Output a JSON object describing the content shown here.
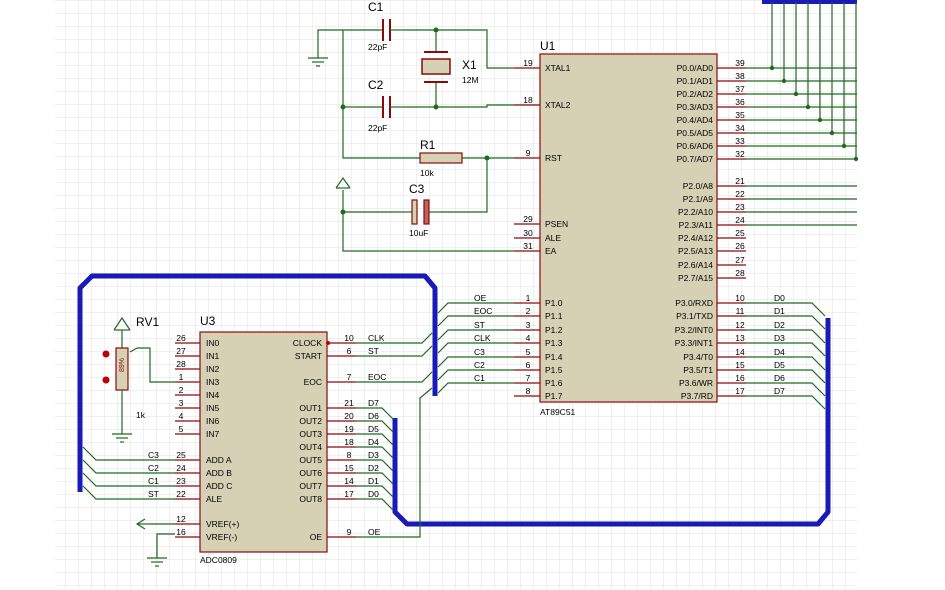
{
  "u1": {
    "ref": "U1",
    "part": "AT89C51",
    "left_pins": [
      {
        "num": "19",
        "name": "XTAL1"
      },
      {
        "num": "18",
        "name": "XTAL2"
      },
      {
        "num": "9",
        "name": "RST"
      },
      {
        "num": "29",
        "name": "PSEN"
      },
      {
        "num": "30",
        "name": "ALE"
      },
      {
        "num": "31",
        "name": "EA"
      },
      {
        "num": "1",
        "name": "P1.0"
      },
      {
        "num": "2",
        "name": "P1.1"
      },
      {
        "num": "3",
        "name": "P1.2"
      },
      {
        "num": "4",
        "name": "P1.3"
      },
      {
        "num": "5",
        "name": "P1.4"
      },
      {
        "num": "6",
        "name": "P1.5"
      },
      {
        "num": "7",
        "name": "P1.6"
      },
      {
        "num": "8",
        "name": "P1.7"
      }
    ],
    "right_pins": [
      {
        "num": "39",
        "name": "P0.0/AD0"
      },
      {
        "num": "38",
        "name": "P0.1/AD1"
      },
      {
        "num": "37",
        "name": "P0.2/AD2"
      },
      {
        "num": "36",
        "name": "P0.3/AD3"
      },
      {
        "num": "35",
        "name": "P0.4/AD4"
      },
      {
        "num": "34",
        "name": "P0.5/AD5"
      },
      {
        "num": "33",
        "name": "P0.6/AD6"
      },
      {
        "num": "32",
        "name": "P0.7/AD7"
      },
      {
        "num": "21",
        "name": "P2.0/A8"
      },
      {
        "num": "22",
        "name": "P2.1/A9"
      },
      {
        "num": "23",
        "name": "P2.2/A10"
      },
      {
        "num": "24",
        "name": "P2.3/A11"
      },
      {
        "num": "25",
        "name": "P2.4/A12"
      },
      {
        "num": "26",
        "name": "P2.5/A13"
      },
      {
        "num": "27",
        "name": "P2.6/A14"
      },
      {
        "num": "28",
        "name": "P2.7/A15"
      },
      {
        "num": "10",
        "name": "P3.0/RXD"
      },
      {
        "num": "11",
        "name": "P3.1/TXD"
      },
      {
        "num": "12",
        "name": "P3.2/INT0"
      },
      {
        "num": "13",
        "name": "P3.3/INT1"
      },
      {
        "num": "14",
        "name": "P3.4/T0"
      },
      {
        "num": "15",
        "name": "P3.5/T1"
      },
      {
        "num": "16",
        "name": "P3.6/WR"
      },
      {
        "num": "17",
        "name": "P3.7/RD"
      }
    ],
    "p1_nets": [
      "OE",
      "EOC",
      "ST",
      "CLK",
      "C3",
      "C2",
      "C1"
    ],
    "p3_nets": [
      "D0",
      "D1",
      "D2",
      "D3",
      "D4",
      "D5",
      "D6",
      "D7"
    ]
  },
  "u3": {
    "ref": "U3",
    "part": "ADC0809",
    "left_pins": [
      {
        "num": "26",
        "name": "IN0"
      },
      {
        "num": "27",
        "name": "IN1"
      },
      {
        "num": "28",
        "name": "IN2"
      },
      {
        "num": "1",
        "name": "IN3"
      },
      {
        "num": "2",
        "name": "IN4"
      },
      {
        "num": "3",
        "name": "IN5"
      },
      {
        "num": "4",
        "name": "IN6"
      },
      {
        "num": "5",
        "name": "IN7"
      },
      {
        "num": "25",
        "name": "ADD A"
      },
      {
        "num": "24",
        "name": "ADD B"
      },
      {
        "num": "23",
        "name": "ADD C"
      },
      {
        "num": "22",
        "name": "ALE"
      },
      {
        "num": "12",
        "name": "VREF(+)"
      },
      {
        "num": "16",
        "name": "VREF(-)"
      }
    ],
    "right_pins": [
      {
        "num": "10",
        "name": "CLOCK"
      },
      {
        "num": "6",
        "name": "START"
      },
      {
        "num": "7",
        "name": "EOC"
      },
      {
        "num": "21",
        "name": "OUT1"
      },
      {
        "num": "20",
        "name": "OUT2"
      },
      {
        "num": "19",
        "name": "OUT3"
      },
      {
        "num": "18",
        "name": "OUT4"
      },
      {
        "num": "8",
        "name": "OUT5"
      },
      {
        "num": "15",
        "name": "OUT6"
      },
      {
        "num": "14",
        "name": "OUT7"
      },
      {
        "num": "17",
        "name": "OUT8"
      },
      {
        "num": "9",
        "name": "OE"
      }
    ],
    "left_nets": [
      "C3",
      "C2",
      "C1",
      "ST"
    ],
    "right_nets": [
      "CLK",
      "ST",
      "EOC",
      "D7",
      "D6",
      "D5",
      "D4",
      "D3",
      "D2",
      "D1",
      "D0",
      "OE"
    ]
  },
  "components": {
    "c1": {
      "ref": "C1",
      "value": "22pF"
    },
    "c2": {
      "ref": "C2",
      "value": "22pF"
    },
    "c3": {
      "ref": "C3",
      "value": "10uF"
    },
    "r1": {
      "ref": "R1",
      "value": "10k"
    },
    "x1": {
      "ref": "X1",
      "value": "12M"
    },
    "rv1": {
      "ref": "RV1",
      "value": "1k",
      "percent": "89%"
    }
  },
  "colors": {
    "wire": "#1e6b1e",
    "pin": "#8a0a0a",
    "body": "#d6d0b4",
    "bus": "#1a1ab8",
    "grid": "#e2e2e2"
  }
}
